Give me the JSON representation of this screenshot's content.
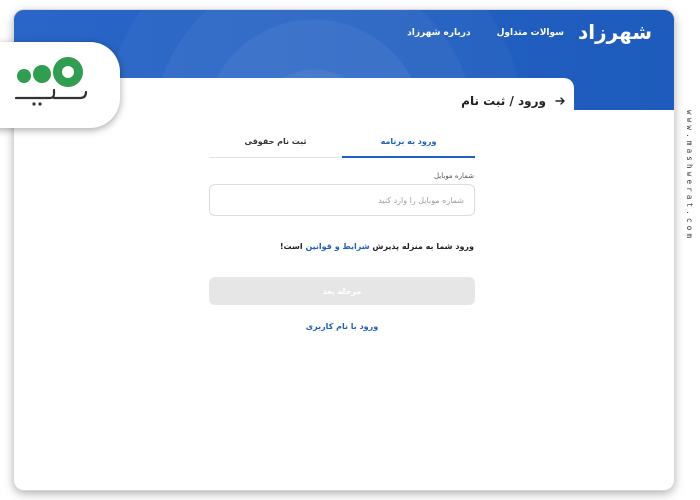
{
  "header": {
    "logo": "شهرزاد",
    "nav": [
      {
        "label": "سوالات متداول"
      },
      {
        "label": "درباره شهرزاد"
      }
    ]
  },
  "card": {
    "title": "ورود / ثبت نام",
    "tabs": [
      {
        "label": "ورود به برنامه",
        "active": true
      },
      {
        "label": "ثبت نام حقوقی",
        "active": false
      }
    ],
    "phone_label": "شماره موبایل",
    "phone_placeholder": "شماره موبایل را وارد کنید",
    "phone_value": "",
    "terms_prefix": "ورود شما به منزله پذیرش",
    "terms_link": "شرایط و قوانین",
    "terms_suffix": "است!",
    "next_button": "مرحله بعد",
    "alt_login": "ورود با نام کاربری"
  },
  "watermark": {
    "side_text": "www.mashwerat.com",
    "brand_icon": "mashwerat-logo-icon"
  },
  "colors": {
    "primary": "#1f5fbf",
    "disabled_button": "#e6e6e6",
    "brand_green": "#2f9e50"
  }
}
